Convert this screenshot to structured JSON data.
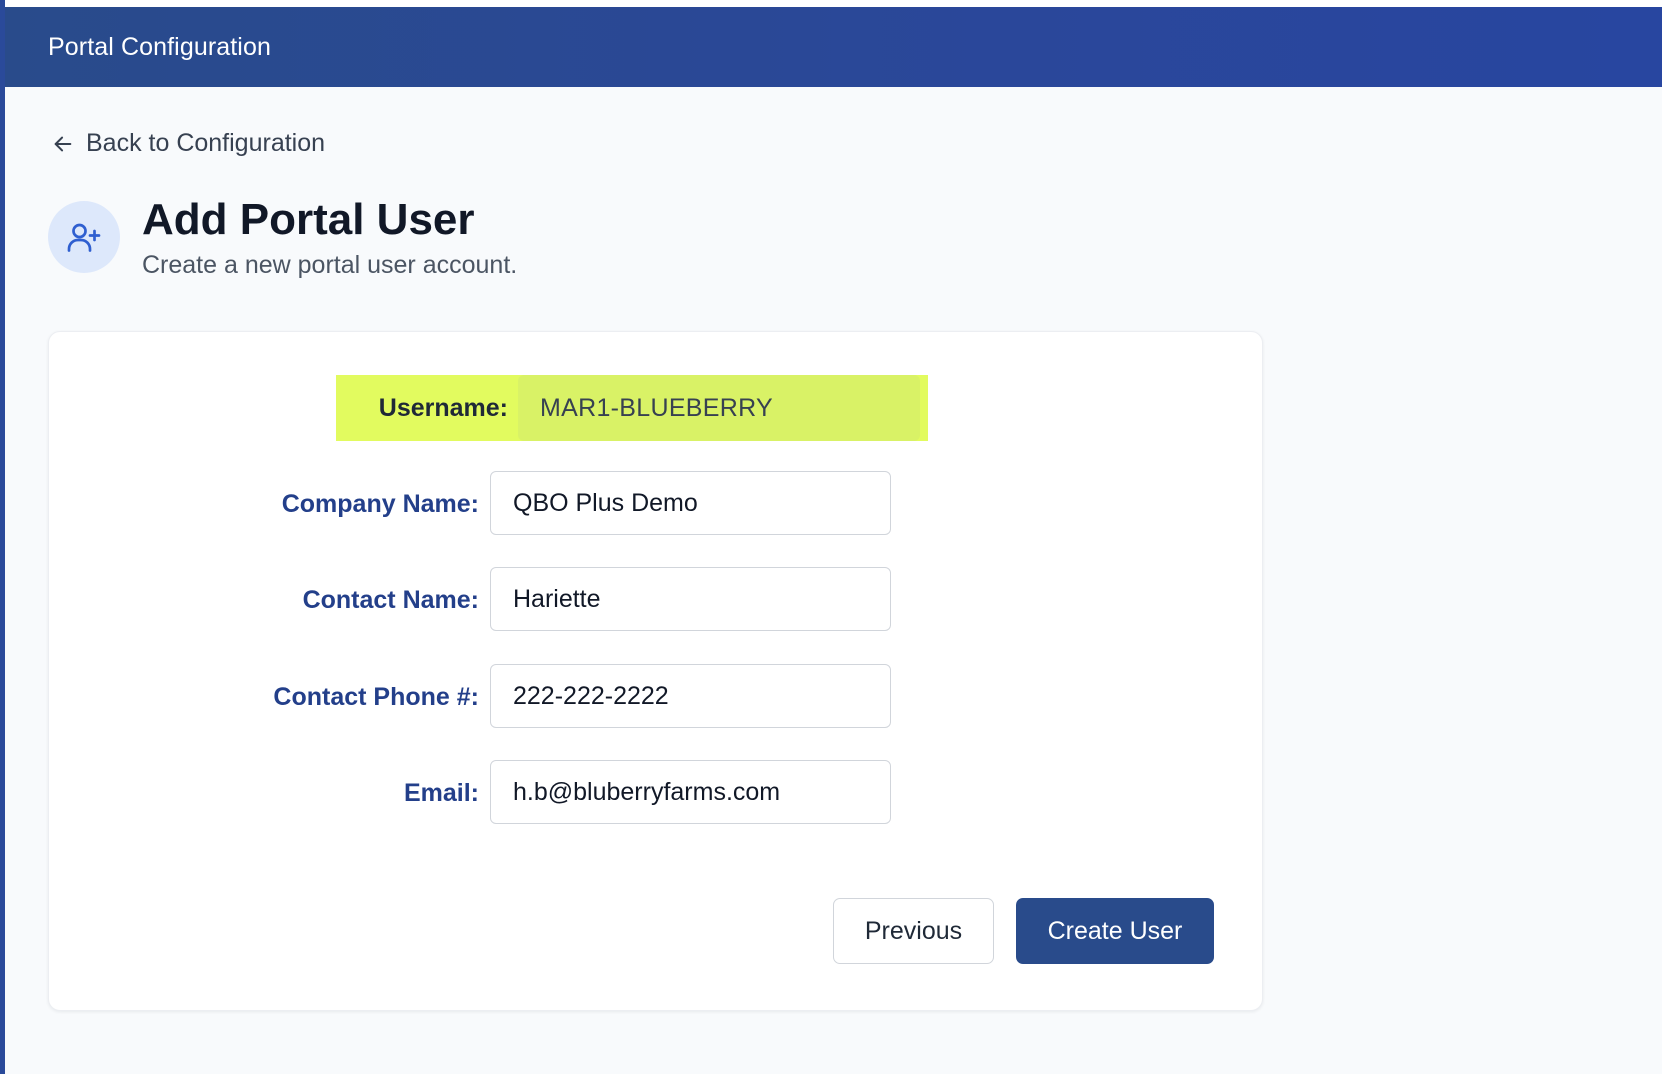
{
  "header": {
    "title": "Portal Configuration"
  },
  "nav": {
    "back_label": "Back to Configuration"
  },
  "page": {
    "title": "Add Portal User",
    "subtitle": "Create a new portal user account."
  },
  "form": {
    "username": {
      "label": "Username:",
      "value": "MAR1-BLUEBERRY"
    },
    "company_name": {
      "label": "Company Name:",
      "value": "QBO Plus Demo"
    },
    "contact_name": {
      "label": "Contact Name:",
      "value": "Hariette"
    },
    "contact_phone": {
      "label": "Contact Phone #:",
      "value": "222-222-2222"
    },
    "email": {
      "label": "Email:",
      "value": "h.b@bluberryfarms.com"
    }
  },
  "actions": {
    "previous_label": "Previous",
    "create_label": "Create User"
  },
  "icons": {
    "back": "arrow-left-icon",
    "page": "user-plus-icon"
  },
  "colors": {
    "header_bg": "#294b8b",
    "primary": "#294b8b",
    "label_blue": "#233f8a",
    "highlight": "#e2fb5f",
    "page_bg": "#f8fafc"
  }
}
